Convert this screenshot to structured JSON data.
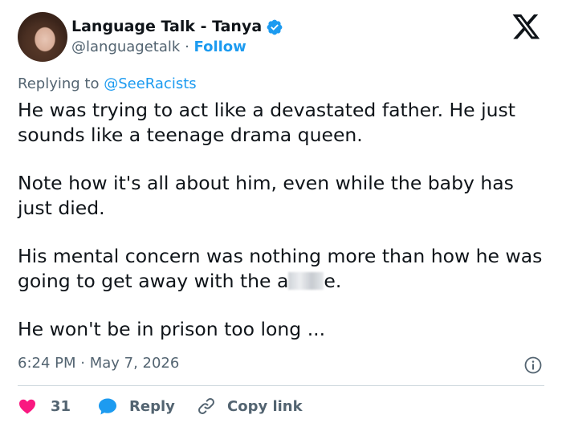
{
  "author": {
    "name": "Language Talk - Tanya",
    "handle": "@languagetalk",
    "separator": "·",
    "follow_label": "Follow",
    "verified_icon": "verified-badge-icon",
    "verified_color": "#1d9bf0"
  },
  "platform_logo": "x-logo-icon",
  "replying": {
    "prefix": "Replying to",
    "mention": "@SeeRacists"
  },
  "tweet": {
    "paragraphs": [
      "He was trying to act like a devastated father. He just sounds like a teenage drama queen.",
      "Note how it's all about him, even while the baby has just died.",
      "His mental concern was nothing more than how he was going to get away with the a",
      "He won't be in prison too long ..."
    ],
    "para3_tail": "e."
  },
  "meta": {
    "timestamp": "6:24 PM · May 7, 2026"
  },
  "actions": {
    "like_count": "31",
    "reply_label": "Reply",
    "copy_link_label": "Copy link"
  },
  "colors": {
    "accent": "#1d9bf0",
    "like": "#f91880",
    "text": "#0f1419",
    "secondary": "#536471"
  }
}
